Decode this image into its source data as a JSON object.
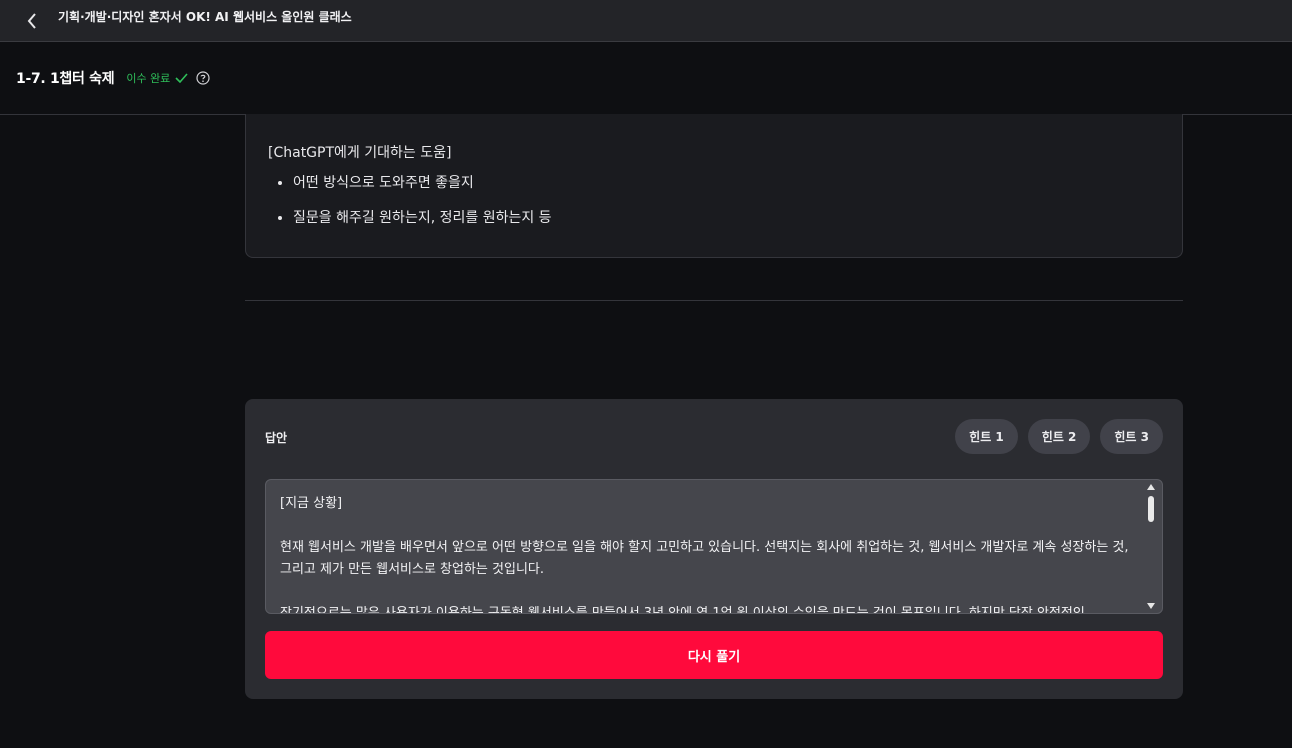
{
  "topbar": {
    "back_icon": "chevron-left-icon",
    "course_title": "기획·개발·디자인 혼자서 OK! AI 웹서비스 올인원 클래스"
  },
  "lesson": {
    "title": "1-7. 1챕터 숙제",
    "status": "이수 완료",
    "status_icon": "check-icon",
    "help_icon": "question-circle-icon",
    "status_color": "#2fbf5a"
  },
  "prompt": {
    "heading": "[ChatGPT에게 기대하는 도움]",
    "items": [
      "어떤 방식으로 도와주면 좋을지",
      "질문을 해주길 원하는지, 정리를 원하는지 등"
    ]
  },
  "answer": {
    "label": "답안",
    "hints": [
      "힌트 1",
      "힌트 2",
      "힌트 3"
    ],
    "text": "[지금 상황]\n\n현재 웹서비스 개발을 배우면서 앞으로 어떤 방향으로 일을 해야 할지 고민하고 있습니다. 선택지는 회사에 취업하는 것, 웹서비스 개발자로 계속 성장하는 것, 그리고 제가 만든 웹서비스로 창업하는 것입니다.\n\n장기적으로는 많은 사용자가 이용하는 구독형 웹서비스를 만들어서 3년 안에 연 1억 원 이상의 수익을 만드는 것이 목표입니다. 하지만 당장 안정적인",
    "retry_label": "다시 풀기",
    "retry_color": "#ff0a3c"
  }
}
